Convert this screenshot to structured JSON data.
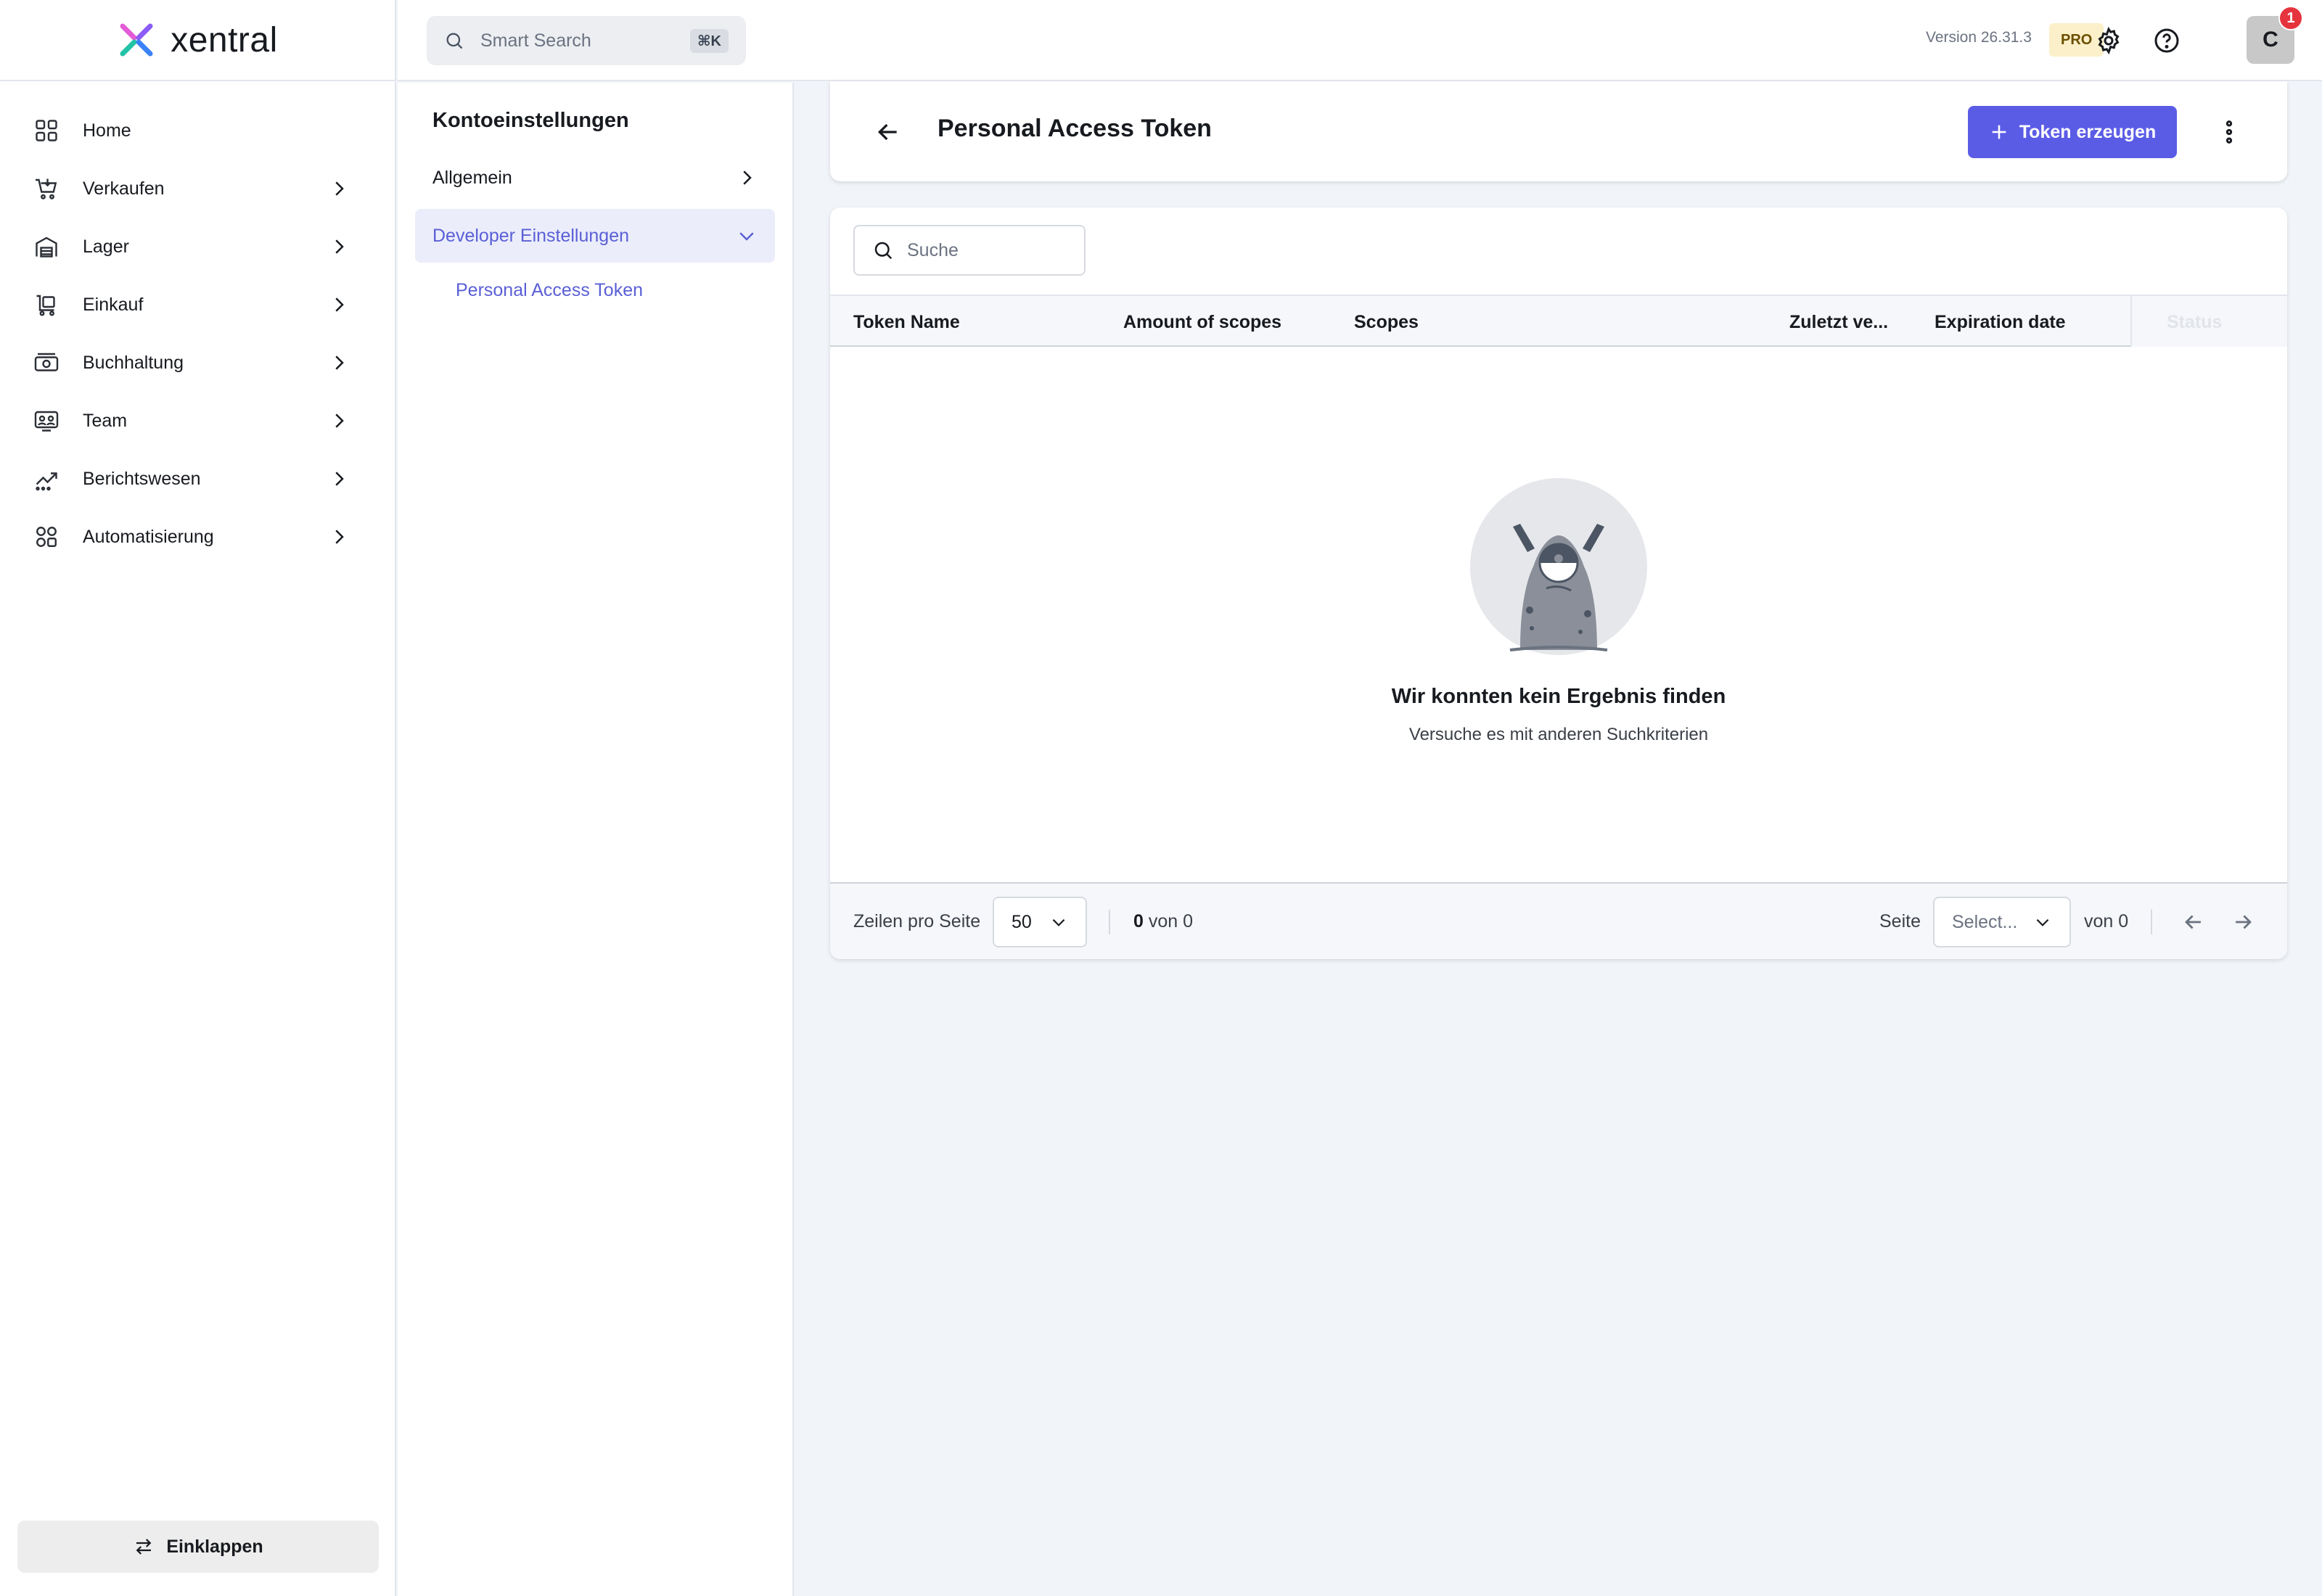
{
  "brand": {
    "name": "xentral"
  },
  "sidebar": {
    "items": [
      {
        "label": "Home",
        "icon": "home-grid-icon"
      },
      {
        "label": "Verkaufen",
        "icon": "cart-icon"
      },
      {
        "label": "Lager",
        "icon": "warehouse-icon"
      },
      {
        "label": "Einkauf",
        "icon": "purchase-icon"
      },
      {
        "label": "Buchhaltung",
        "icon": "cash-icon"
      },
      {
        "label": "Team",
        "icon": "team-icon"
      },
      {
        "label": "Berichtswesen",
        "icon": "chart-icon"
      },
      {
        "label": "Automatisierung",
        "icon": "automation-icon"
      }
    ],
    "collapse_label": "Einklappen"
  },
  "header": {
    "search_placeholder": "Smart Search",
    "shortcut": "⌘K",
    "version": "Version 26.31.3",
    "plan_badge": "PRO",
    "avatar_initial": "C",
    "notification_count": "1"
  },
  "settings": {
    "title": "Kontoeinstellungen",
    "items": [
      {
        "label": "Allgemein"
      },
      {
        "label": "Developer Einstellungen"
      }
    ],
    "sub_item": "Personal Access Token"
  },
  "page": {
    "title": "Personal Access Token",
    "create_button": "Token erzeugen"
  },
  "table": {
    "search_placeholder": "Suche",
    "columns": [
      "Token Name",
      "Amount of scopes",
      "Scopes",
      "Zuletzt ve...",
      "Expiration date",
      "Status"
    ],
    "rows": [],
    "empty_title": "Wir konnten kein Ergebnis finden",
    "empty_subtitle": "Versuche es mit anderen Suchkriterien"
  },
  "pagination": {
    "rows_label": "Zeilen pro Seite",
    "rows_per_page": "50",
    "count_start": "0",
    "count_rest": "von 0",
    "page_label": "Seite",
    "page_placeholder": "Select...",
    "page_total": "von 0"
  },
  "colors": {
    "accent": "#5b5ce6",
    "active_bg": "#ebedfb",
    "active_text": "#5a5fd6",
    "badge_pro_bg": "#fbf0c9",
    "notification": "#e5343e",
    "background": "#f1f4f9"
  }
}
